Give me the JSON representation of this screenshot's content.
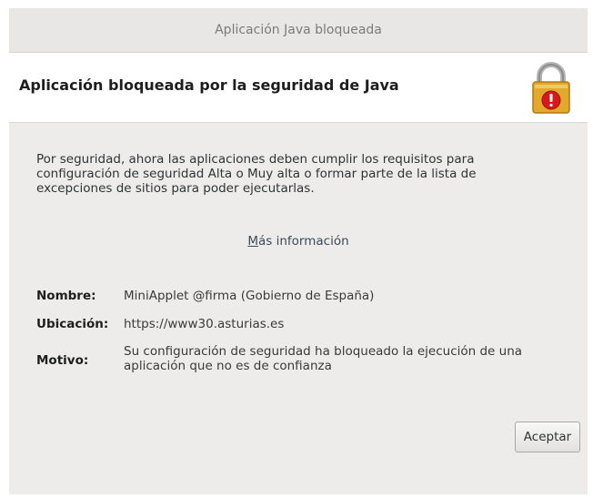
{
  "window": {
    "title": "Aplicación Java bloqueada"
  },
  "header": {
    "title": "Aplicación bloqueada por la seguridad de Java",
    "icon": "lock-warning-icon"
  },
  "body": {
    "message_lines": [
      "Por seguridad, ahora las aplicaciones deben cumplir los requisitos para",
      "configuración de seguridad Alta o Muy alta o formar parte de la lista de",
      "excepciones de sitios para poder ejecutarlas."
    ],
    "more_info_link_first": "M",
    "more_info_link_rest": "ás información"
  },
  "details": {
    "name_label": "Nombre:",
    "name_value": "MiniApplet @firma (Gobierno de España)",
    "location_label": "Ubicación:",
    "location_value": "https://www30.asturias.es",
    "reason_label": "Motivo:",
    "reason_value_lines": [
      "Su configuración de seguridad ha bloqueado la ejecución de una",
      "aplicación que no es de confianza"
    ]
  },
  "buttons": {
    "accept_label": "Aceptar"
  },
  "colors": {
    "dialog_bg": "#edeceb",
    "header_bg": "#ffffff",
    "lock_gold": "#e3a92a",
    "warning_red": "#d7191c"
  }
}
